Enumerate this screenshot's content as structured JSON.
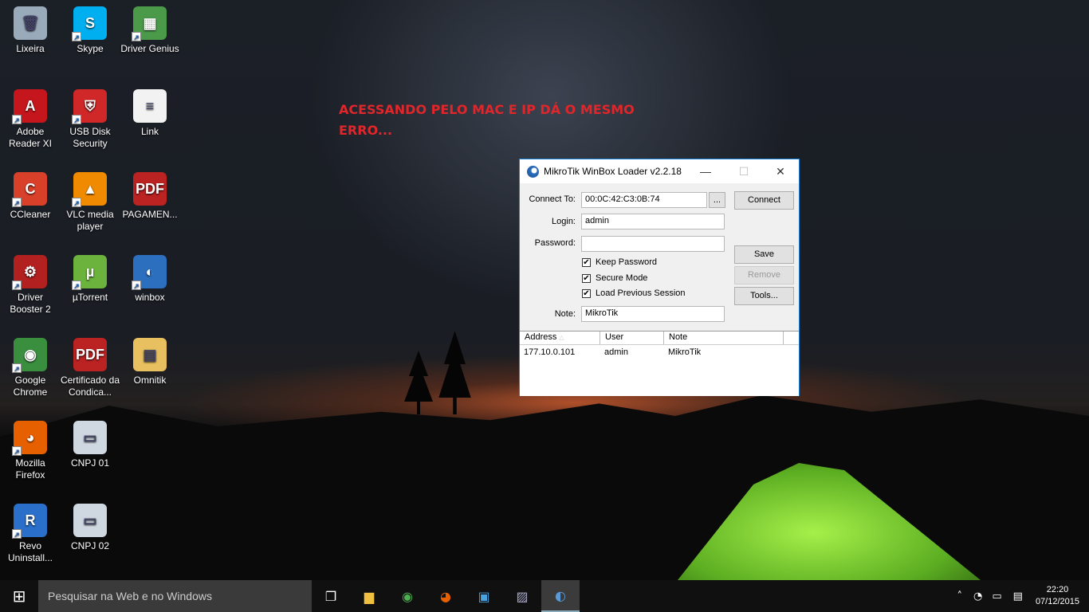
{
  "annotation": "ACESSANDO PELO MAC E IP DÁ O MESMO ERRO...",
  "desktop_icons": [
    {
      "label": "Lixeira",
      "glyph": "🗑",
      "color": "#9ab",
      "col": 0,
      "row": 0,
      "shortcut": false
    },
    {
      "label": "Adobe Reader XI",
      "glyph": "A",
      "color": "#c4161c",
      "col": 0,
      "row": 1,
      "shortcut": true
    },
    {
      "label": "CCleaner",
      "glyph": "C",
      "color": "#d8402a",
      "col": 0,
      "row": 2,
      "shortcut": true
    },
    {
      "label": "Driver Booster 2",
      "glyph": "⚙",
      "color": "#b32020",
      "col": 0,
      "row": 3,
      "shortcut": true
    },
    {
      "label": "Google Chrome",
      "glyph": "◉",
      "color": "#3a8f3f",
      "col": 0,
      "row": 4,
      "shortcut": true
    },
    {
      "label": "Mozilla Firefox",
      "glyph": "◕",
      "color": "#e66000",
      "col": 0,
      "row": 5,
      "shortcut": true
    },
    {
      "label": "Revo Uninstall...",
      "glyph": "R",
      "color": "#2a6fc9",
      "col": 0,
      "row": 6,
      "shortcut": true
    },
    {
      "label": "Skype",
      "glyph": "S",
      "color": "#00aff0",
      "col": 1,
      "row": 0,
      "shortcut": true
    },
    {
      "label": "USB Disk Security",
      "glyph": "⛨",
      "color": "#d02828",
      "col": 1,
      "row": 1,
      "shortcut": true
    },
    {
      "label": "VLC media player",
      "glyph": "▲",
      "color": "#f08a00",
      "col": 1,
      "row": 2,
      "shortcut": true
    },
    {
      "label": "µTorrent",
      "glyph": "µ",
      "color": "#6cb33e",
      "col": 1,
      "row": 3,
      "shortcut": true
    },
    {
      "label": "Certificado da Condica...",
      "glyph": "PDF",
      "color": "#b22",
      "col": 1,
      "row": 4,
      "shortcut": false
    },
    {
      "label": "CNPJ 01",
      "glyph": "▭",
      "color": "#cfd8e0",
      "col": 1,
      "row": 5,
      "shortcut": false
    },
    {
      "label": "CNPJ 02",
      "glyph": "▭",
      "color": "#cfd8e0",
      "col": 1,
      "row": 6,
      "shortcut": false
    },
    {
      "label": "Driver Genius",
      "glyph": "▦",
      "color": "#4a9a4a",
      "col": 2,
      "row": 0,
      "shortcut": true
    },
    {
      "label": "Link",
      "glyph": "≡",
      "color": "#f2f2f2",
      "col": 2,
      "row": 1,
      "shortcut": false
    },
    {
      "label": "PAGAMEN...",
      "glyph": "PDF",
      "color": "#b22",
      "col": 2,
      "row": 2,
      "shortcut": false
    },
    {
      "label": "winbox",
      "glyph": "◐",
      "color": "#2c6fbf",
      "col": 2,
      "row": 3,
      "shortcut": true
    },
    {
      "label": "Omnitik",
      "glyph": "▤",
      "color": "#e8c060",
      "col": 2,
      "row": 4,
      "shortcut": false
    }
  ],
  "window": {
    "title": "MikroTik WinBox Loader v2.2.18",
    "minimize": "—",
    "maximize": "☐",
    "close": "✕",
    "connect_to_label": "Connect To:",
    "connect_to_value": "00:0C:42:C3:0B:74",
    "browse": "...",
    "login_label": "Login:",
    "login_value": "admin",
    "password_label": "Password:",
    "password_value": "",
    "keep_password": "Keep Password",
    "secure_mode": "Secure Mode",
    "load_previous": "Load Previous Session",
    "check": "✔",
    "note_label": "Note:",
    "note_value": "MikroTik",
    "connect_btn": "Connect",
    "save_btn": "Save",
    "remove_btn": "Remove",
    "tools_btn": "Tools...",
    "columns": [
      "Address",
      "User",
      "Note"
    ],
    "rows": [
      {
        "address": "177.10.0.101",
        "user": "admin",
        "note": "MikroTik"
      }
    ]
  },
  "taskbar": {
    "start": "⊞",
    "search_placeholder": "Pesquisar na Web e no Windows",
    "time": "22:20",
    "date": "07/12/2015"
  }
}
